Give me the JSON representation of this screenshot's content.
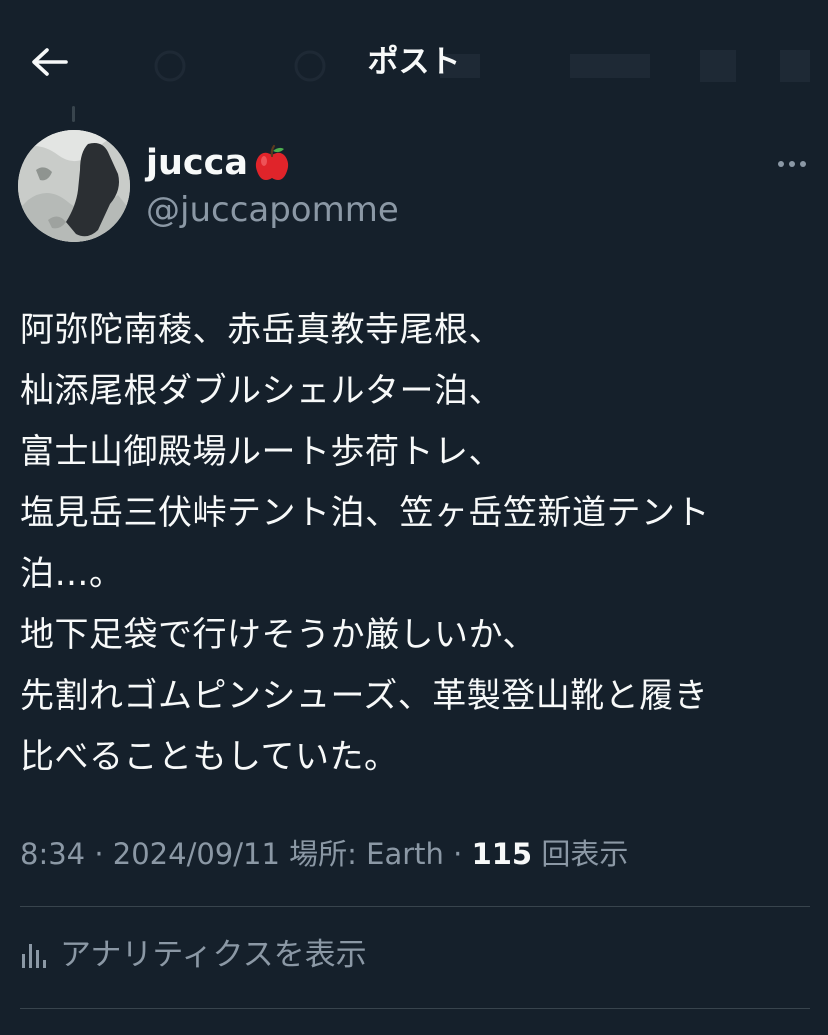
{
  "header": {
    "title": "ポスト",
    "back_icon": "arrow-left-icon"
  },
  "author": {
    "display_name": "jucca",
    "emoji_icon": "red-apple-icon",
    "handle": "@juccapomme",
    "more_icon": "more-horizontal-icon"
  },
  "tweet": {
    "lines": [
      "阿弥陀南稜、赤岳真教寺尾根、",
      "杣添尾根ダブルシェルター泊、",
      "富士山御殿場ルート歩荷トレ、",
      "塩見岳三伏峠テント泊、笠ヶ岳笠新道テント",
      "泊…。",
      "地下足袋で行けそうか厳しいか、",
      "先割れゴムピンシューズ、革製登山靴と履き",
      "比べることもしていた。"
    ]
  },
  "meta": {
    "time": "8:34",
    "sep1": " · ",
    "date": "2024/09/11",
    "location": " 場所: Earth",
    "sep2": " · ",
    "views_count": "115",
    "views_label": " 回表示"
  },
  "analytics": {
    "label": "アナリティクスを表示",
    "icon": "bar-chart-icon"
  },
  "colors": {
    "background": "#15202b",
    "text_primary": "#f7f9f9",
    "text_secondary": "#8b98a5",
    "divider": "#38444d"
  }
}
